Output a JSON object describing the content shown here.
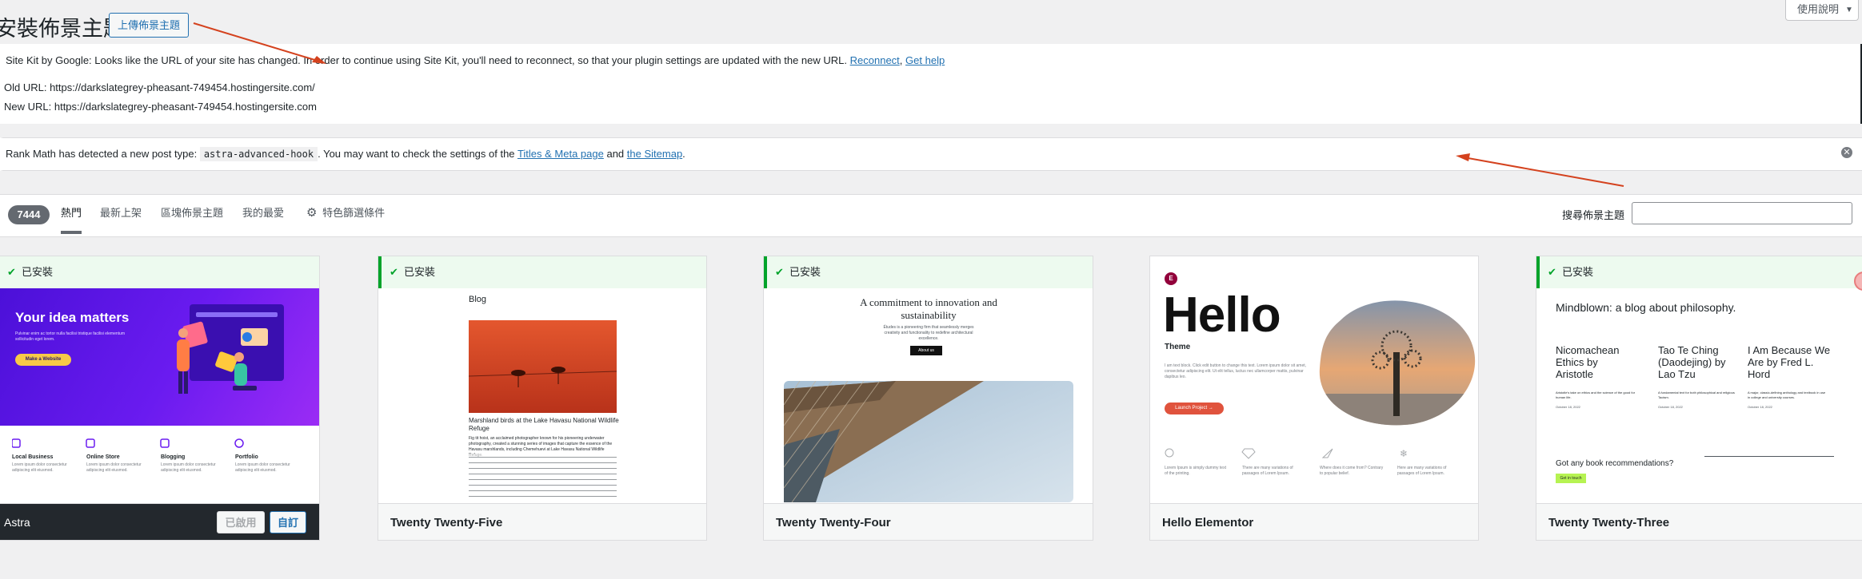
{
  "header": {
    "title": "安裝佈景主題",
    "upload_label": "上傳佈景主題",
    "help_label": "使用說明"
  },
  "notices": {
    "sitekit": {
      "message_start": "Site Kit by Google: Looks like the URL of your site has changed. In order to continue using Site Kit, you'll need to reconnect, so that your plugin settings are updated with the new URL.",
      "reconnect": "Reconnect",
      "comma": ",",
      "get_help": "Get help",
      "old_url": "Old URL: https://darkslategrey-pheasant-749454.hostingersite.com/",
      "new_url": "New URL: https://darkslategrey-pheasant-749454.hostingersite.com"
    },
    "rankmath": {
      "part1": "Rank Math has detected a new post type:",
      "post_type": "astra-advanced-hook",
      "part2": ". You may want to check the settings of the",
      "link1": "Titles & Meta page",
      "and": "and",
      "link2": "the Sitemap",
      "period": "."
    }
  },
  "filter": {
    "count": "7444",
    "tabs": [
      "熱門",
      "最新上架",
      "區塊佈景主題",
      "我的最愛"
    ],
    "feature_filter": "特色篩選條件",
    "search_label": "搜尋佈景主題"
  },
  "themes": [
    {
      "name": "Astra",
      "installed": "已安裝",
      "activated_label": "已啟用",
      "customize_label": "自訂",
      "preview": {
        "headline": "Your idea matters",
        "subtext": "Pulvinar enim ac tortor nulla facilisi tristique facilisi elementum sollicitudin eget lorem.",
        "cta": "Make a Website",
        "items": [
          {
            "title": "Local Business",
            "text": "Lorem ipsum dolor consectetur adipiscing elit eiusmod."
          },
          {
            "title": "Online Store",
            "text": "Lorem ipsum dolor consectetur adipiscing elit eiusmod."
          },
          {
            "title": "Blogging",
            "text": "Lorem ipsum dolor consectetur adipiscing elit eiusmod."
          },
          {
            "title": "Portfolio",
            "text": "Lorem ipsum dolor consectetur adipiscing elit eiusmod."
          }
        ]
      }
    },
    {
      "name": "Twenty Twenty-Five",
      "installed": "已安裝",
      "preview": {
        "blog": "Blog",
        "caption": "Marshland birds at the Lake Havasu National Wildlife Refuge",
        "body": "Fig tit hoist, an acclaimed photographer known for his pioneering underwater photography, created a stunning series of images that capture the essence of the Havasu marshlands, including Chemehuevi at Lake Havasu National Wildlife Refuge."
      }
    },
    {
      "name": "Twenty Twenty-Four",
      "installed": "已安裝",
      "preview": {
        "heading": "A commitment to innovation and sustainability",
        "sub": "Études is a pioneering firm that seamlessly merges creativity and functionality to redefine architectural excellence.",
        "button": "About us"
      }
    },
    {
      "name": "Hello Elementor",
      "installed": "",
      "preview": {
        "hello": "Hello",
        "theme": "Theme",
        "body": "I am text block. Click edit button to change this text. Lorem ipsum dolor sit amet, consectetur adipiscing elit. Ut elit tellus, luctus nec ullamcorper mattis, pulvinar dapibus leo.",
        "cta": "Launch Project →",
        "features": [
          "Lorem Ipsum is simply dummy text of the printing.",
          "There are many variations of passages of Lorem Ipsum.",
          "Where does it come from? Contrary to popular belief.",
          "Here are many variations of passages of Lorem Ipsum."
        ]
      }
    },
    {
      "name": "Twenty Twenty-Three",
      "installed": "已安裝",
      "preview": {
        "headline": "Mindblown: a blog about philosophy.",
        "posts": [
          {
            "title": "Nicomachean Ethics by Aristotle",
            "excerpt": "Aristotle's take on ethics and the science of the good for human life.",
            "date": "October 18, 2022"
          },
          {
            "title": "Tao Te Ching (Daodejing) by Lao Tzu",
            "excerpt": "A fundamental text for both philosophical and religious Taoism.",
            "date": "October 18, 2022"
          },
          {
            "title": "I Am Because We Are by Fred L. Hord",
            "excerpt": "A major, classic-defining anthology and textbook in use in college and university courses.",
            "date": "October 18, 2022"
          }
        ],
        "question": "Got any book recommendations?",
        "button": "Get in touch"
      }
    }
  ],
  "colors": {
    "accent": "#2271b1",
    "installed_green": "#00a32a",
    "annotation_arrow": "#d4421e"
  }
}
